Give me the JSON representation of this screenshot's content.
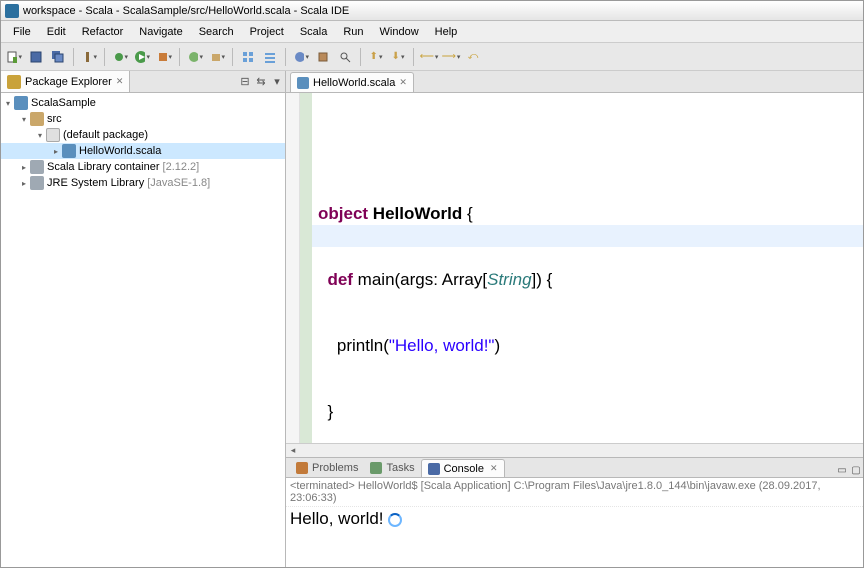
{
  "title": "workspace - Scala - ScalaSample/src/HelloWorld.scala - Scala IDE",
  "menu": [
    "File",
    "Edit",
    "Refactor",
    "Navigate",
    "Search",
    "Project",
    "Scala",
    "Run",
    "Window",
    "Help"
  ],
  "pkg_explorer": {
    "title": "Package Explorer",
    "project": "ScalaSample",
    "src": "src",
    "default_pkg": "(default package)",
    "file": "HelloWorld.scala",
    "scala_lib": "Scala Library container",
    "scala_lib_ver": "[2.12.2]",
    "jre": "JRE System Library",
    "jre_ver": "[JavaSE-1.8]"
  },
  "editor": {
    "tab": "HelloWorld.scala",
    "code": {
      "l1_kw": "object",
      "l1_cls": "HelloWorld",
      "l1_rest": " {",
      "l2_kw": "def",
      "l2_name": " main(args: Array[",
      "l2_typ": "String",
      "l2_rest": "]) {",
      "l3_a": "    println(",
      "l3_str": "\"Hello, world!\"",
      "l3_b": ")",
      "l4": "  }",
      "l5": "}"
    }
  },
  "bottom_tabs": {
    "problems": "Problems",
    "tasks": "Tasks",
    "console": "Console"
  },
  "console": {
    "header": "<terminated> HelloWorld$ [Scala Application] C:\\Program Files\\Java\\jre1.8.0_144\\bin\\javaw.exe (28.09.2017, 23:06:33)",
    "output": "Hello, world!"
  },
  "colors": {
    "scala_file": "#5a8fbd",
    "folder": "#c9a23a",
    "pkg": "#caa76a",
    "lib": "#9fa9b3"
  }
}
